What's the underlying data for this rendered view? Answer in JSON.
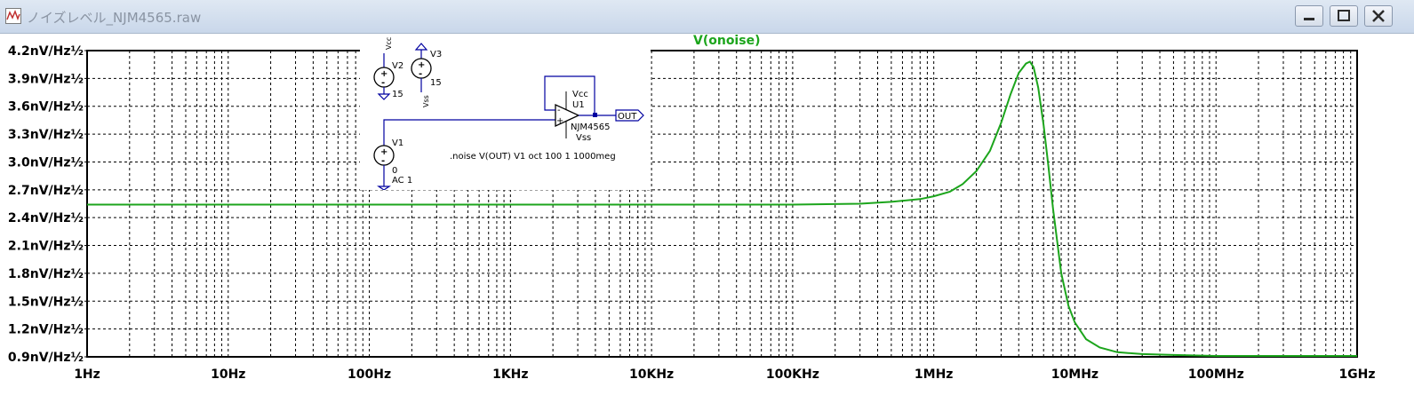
{
  "window": {
    "title": "ノイズレベル_NJM4565.raw"
  },
  "colors": {
    "trace": "#1ca51c",
    "grid": "#000000",
    "schematic_wire": "#0000a0"
  },
  "schematic": {
    "v2_label": "V2",
    "v2_value": "15",
    "v2_net": "Vcc",
    "v3_label": "V3",
    "v3_value": "15",
    "v3_net": "Vss",
    "v1_label": "V1",
    "v1_value": "0",
    "v1_ac": "AC 1",
    "u1_label": "U1",
    "u1_vcc": "Vcc",
    "u1_vss": "Vss",
    "u1_model": "NJM4565",
    "out_label": "OUT",
    "directive": ".noise V(OUT) V1 oct 100 1 1000meg"
  },
  "chart_data": {
    "type": "line",
    "title": "V(onoise)",
    "xscale": "log",
    "xlim": [
      1,
      1000000000
    ],
    "ylim": [
      0.9,
      4.2
    ],
    "grid": true,
    "x_tick_labels": [
      "1Hz",
      "10Hz",
      "100Hz",
      "1KHz",
      "10KHz",
      "100KHz",
      "1MHz",
      "10MHz",
      "100MHz",
      "1GHz"
    ],
    "y_tick_labels": [
      "4.2nV/Hz½",
      "3.9nV/Hz½",
      "3.6nV/Hz½",
      "3.3nV/Hz½",
      "3.0nV/Hz½",
      "2.7nV/Hz½",
      "2.4nV/Hz½",
      "2.1nV/Hz½",
      "1.8nV/Hz½",
      "1.5nV/Hz½",
      "1.2nV/Hz½",
      "0.9nV/Hz½"
    ],
    "series": [
      {
        "name": "V(onoise)",
        "x": [
          1,
          10,
          100,
          1000,
          10000,
          100000,
          300000,
          500000,
          800000,
          1000000,
          1300000,
          1600000,
          2000000,
          2500000,
          3000000,
          3500000,
          4000000,
          4500000,
          4800000,
          5100000,
          5500000,
          6000000,
          6500000,
          7000000,
          8000000,
          9000000,
          10000000,
          12000000,
          15000000,
          20000000,
          30000000,
          50000000,
          100000000,
          1000000000
        ],
        "y": [
          2.54,
          2.54,
          2.54,
          2.54,
          2.54,
          2.54,
          2.55,
          2.57,
          2.6,
          2.63,
          2.68,
          2.76,
          2.9,
          3.12,
          3.42,
          3.73,
          3.96,
          4.06,
          4.08,
          4.02,
          3.8,
          3.4,
          2.95,
          2.5,
          1.8,
          1.45,
          1.27,
          1.09,
          1.0,
          0.95,
          0.93,
          0.92,
          0.91,
          0.91
        ]
      }
    ]
  }
}
